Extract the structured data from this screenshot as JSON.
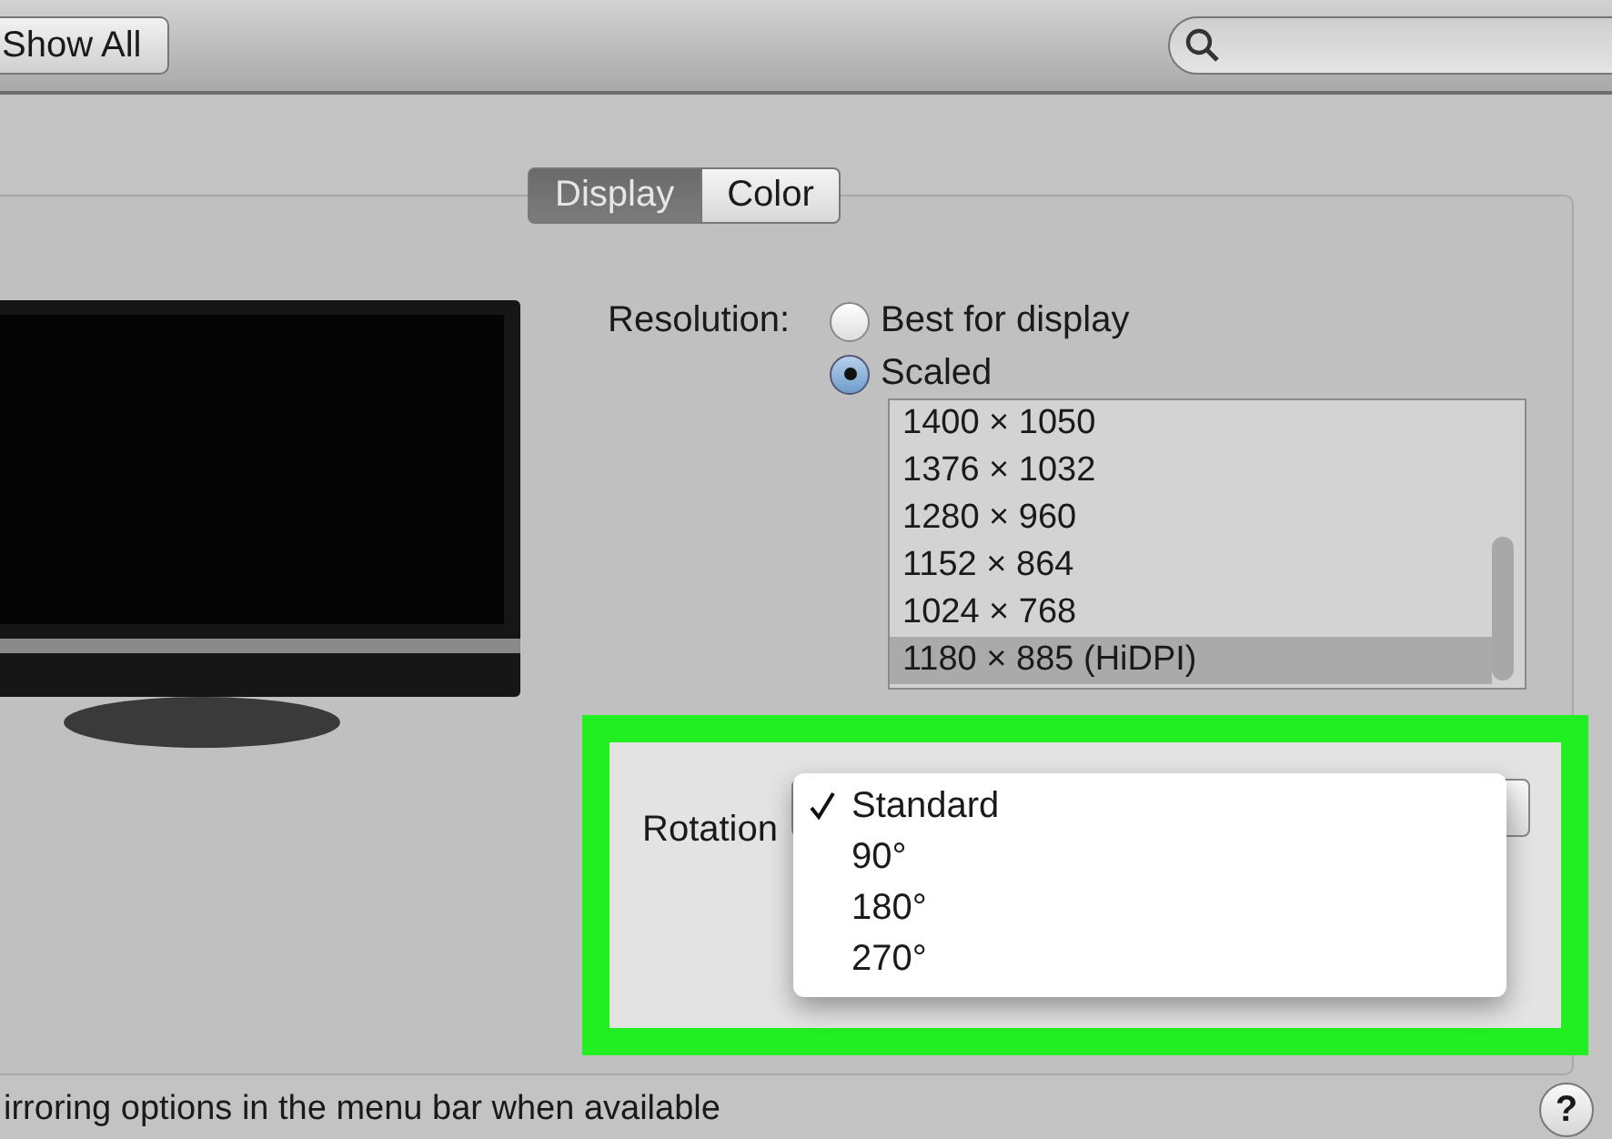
{
  "toolbar": {
    "show_all_button": "Show All"
  },
  "tabs": [
    {
      "label": "Display",
      "selected": true
    },
    {
      "label": "Color",
      "selected": false
    }
  ],
  "resolution": {
    "label": "Resolution:",
    "options": [
      {
        "label": "Best for display",
        "selected": false
      },
      {
        "label": "Scaled",
        "selected": true
      }
    ],
    "sizes": [
      {
        "label": "1400 × 1050",
        "selected": false
      },
      {
        "label": "1376 × 1032",
        "selected": false
      },
      {
        "label": "1280 × 960",
        "selected": false
      },
      {
        "label": "1152 × 864",
        "selected": false
      },
      {
        "label": "1024 × 768",
        "selected": false
      },
      {
        "label": "1180 × 885 (HiDPI)",
        "selected": true
      }
    ]
  },
  "rotation": {
    "label": "Rotation",
    "menu": [
      {
        "label": "Standard",
        "checked": true
      },
      {
        "label": "90°",
        "checked": false
      },
      {
        "label": "180°",
        "checked": false
      },
      {
        "label": "270°",
        "checked": false
      }
    ]
  },
  "footer": {
    "text": "irroring options in the menu bar when available",
    "help_button": "?"
  }
}
